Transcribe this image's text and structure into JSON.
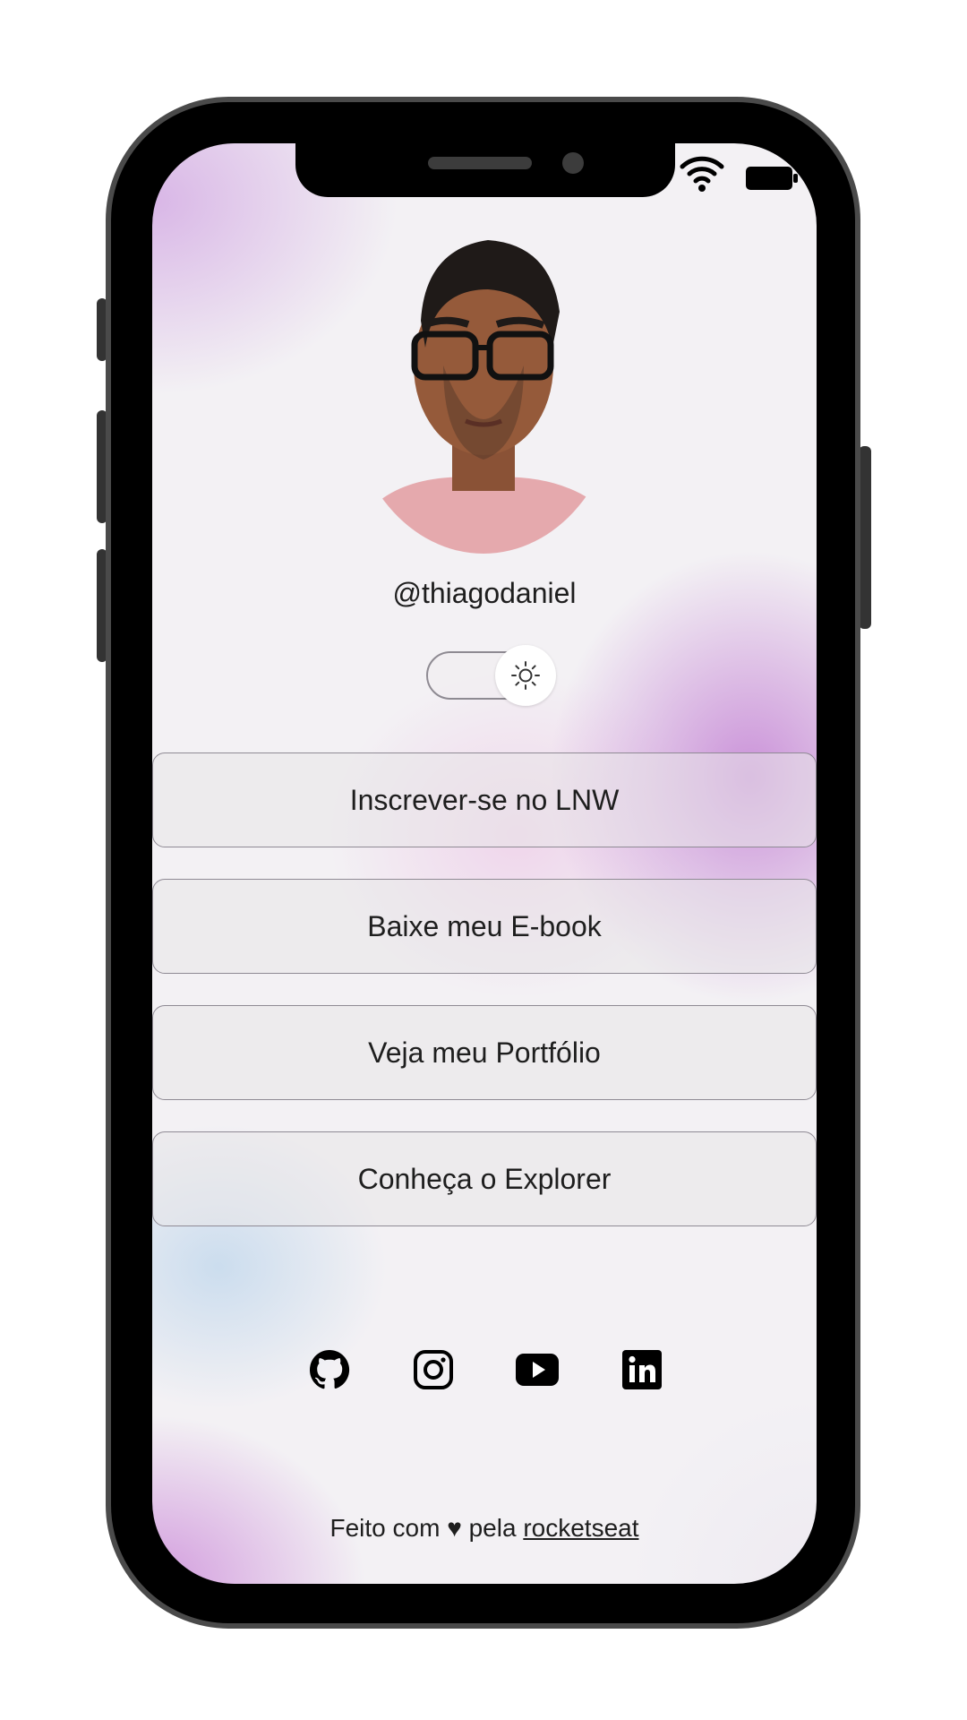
{
  "profile": {
    "username": "@thiagodaniel"
  },
  "theme_toggle": {
    "state": "light",
    "icon": "sun-icon"
  },
  "links": [
    {
      "label": "Inscrever-se no LNW"
    },
    {
      "label": "Baixe meu E-book"
    },
    {
      "label": "Veja meu Portfólio"
    },
    {
      "label": "Conheça o Explorer"
    }
  ],
  "social": [
    {
      "icon": "github-icon"
    },
    {
      "icon": "instagram-icon"
    },
    {
      "icon": "youtube-icon"
    },
    {
      "icon": "linkedin-icon"
    }
  ],
  "footer": {
    "prefix": "Feito com",
    "heart": "♥",
    "middle": "pela",
    "link": "rocketseat"
  },
  "status_bar": {
    "icons": [
      "wifi-icon",
      "battery-icon"
    ]
  },
  "colors": {
    "accent_purple": "#c88cd7",
    "accent_blue": "#bed6ec",
    "text": "#1e1e1e"
  }
}
